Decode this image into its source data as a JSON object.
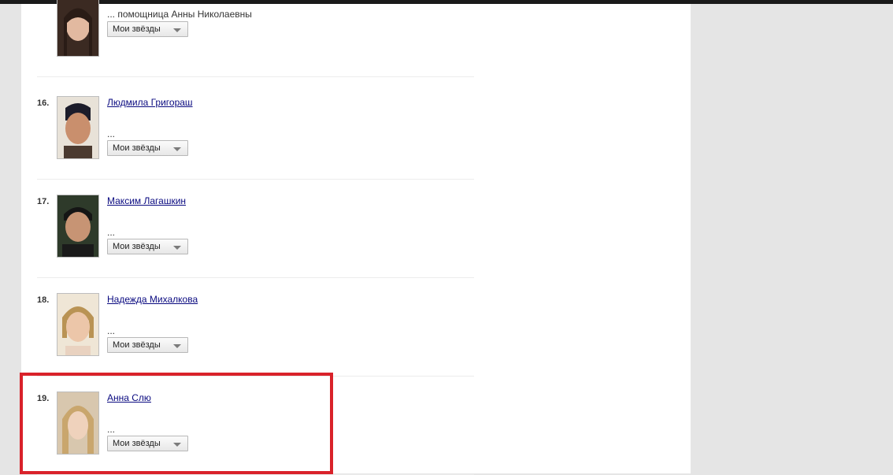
{
  "rows": [
    {
      "number": "",
      "name": "",
      "role": "... помощница Анны Николаевны",
      "select": "Мои звёзды"
    },
    {
      "number": "16.",
      "name": "Людмила Григораш",
      "role": "...",
      "select": "Мои звёзды"
    },
    {
      "number": "17.",
      "name": "Максим Лагашкин",
      "role": "...",
      "select": "Мои звёзды"
    },
    {
      "number": "18.",
      "name": "Надежда Михалкова",
      "role": "...",
      "select": "Мои звёзды"
    },
    {
      "number": "19.",
      "name": "Анна Слю",
      "role": "...",
      "select": "Мои звёзды"
    }
  ],
  "colors": {
    "highlight": "#d9222a",
    "link": "#0a0a80",
    "page_bg": "#e5e5e5"
  }
}
